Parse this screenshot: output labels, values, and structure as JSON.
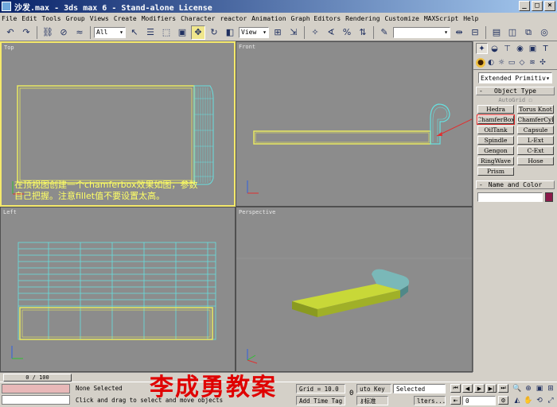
{
  "window": {
    "title": "沙发.max - 3ds max 6 - Stand-alone License",
    "buttons": [
      "_",
      "□",
      "×"
    ]
  },
  "menu": [
    "File",
    "Edit",
    "Tools",
    "Group",
    "Views",
    "Create",
    "Modifiers",
    "Character",
    "reactor",
    "Animation",
    "Graph Editors",
    "Rendering",
    "Customize",
    "MAXScript",
    "Help"
  ],
  "toolbar": {
    "selection_filter": "All",
    "reference_coord": "View",
    "named_selection": ""
  },
  "viewports": {
    "top": "Top",
    "front": "Front",
    "left": "Left",
    "perspective": "Perspective"
  },
  "annotation": {
    "line1": "在顶视图创建一个chamferbox效果如图，参数",
    "line2": "自己把握。注意fillet值不要设置太高。"
  },
  "command_panel": {
    "category_dropdown": "Extended Primitiv",
    "object_type_title": "Object Type",
    "autogrid": "AutoGrid",
    "buttons": [
      "Hedra",
      "Torus Knot",
      "ChamferBox",
      "ChamferCyl",
      "OilTank",
      "Capsule",
      "Spindle",
      "L-Ext",
      "Gengon",
      "C-Ext",
      "RingWave",
      "Hose",
      "Prism"
    ],
    "highlighted": "ChamferBox",
    "name_color_title": "Name and Color",
    "rollout_toggle": "-"
  },
  "timeslider": {
    "label": "0 / 100"
  },
  "status": {
    "selection": "None Selected",
    "prompt": "Click and drag to select and move objects",
    "grid": "Grid = 10.0",
    "add_time_tag": "Add Time Tag",
    "frame": "0",
    "auto_key": "uto Key",
    "selected_dropdown": "Selected",
    "set_key_fragment": "标准",
    "filters_fragment": "lters...",
    "current_frame": "0"
  },
  "watermark": "李成勇教案",
  "colors": {
    "viewport_bg": "#8c8c8c",
    "active_border": "#f5e96b",
    "wire_yellow": "#e8e860",
    "wire_cyan": "#66e0e0",
    "sofa_body": "#b8c830",
    "sofa_arm": "#70b0b0",
    "watermark": "#e00000",
    "swatch": "#8b1a4a"
  }
}
